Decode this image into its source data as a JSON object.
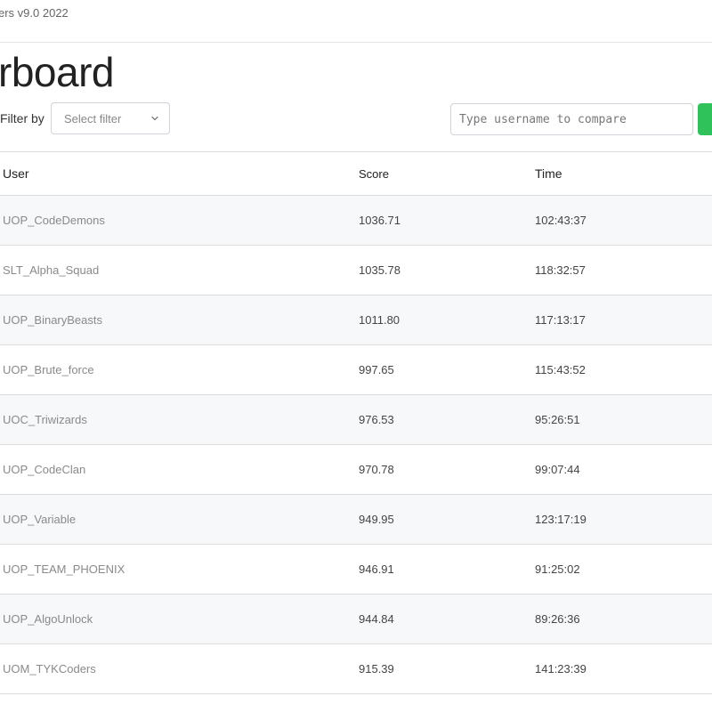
{
  "header": {
    "version_text": "ers v9.0 2022"
  },
  "page": {
    "title": "rboard"
  },
  "filter": {
    "label": "Filter by",
    "placeholder": "Select filter"
  },
  "compare": {
    "placeholder": "Type username to compare",
    "button_color": "#2fc25b"
  },
  "table": {
    "columns": [
      "User",
      "Score",
      "Time",
      ""
    ],
    "rows": [
      {
        "user": "UOP_CodeDemons",
        "score": "1036.71",
        "time": "102:43:37"
      },
      {
        "user": "SLT_Alpha_Squad",
        "score": "1035.78",
        "time": "118:32:57"
      },
      {
        "user": "UOP_BinaryBeasts",
        "score": "1011.80",
        "time": "117:13:17"
      },
      {
        "user": "UOP_Brute_force",
        "score": "997.65",
        "time": "115:43:52"
      },
      {
        "user": "UOC_Triwizards",
        "score": "976.53",
        "time": "95:26:51"
      },
      {
        "user": "UOP_CodeClan",
        "score": "970.78",
        "time": "99:07:44"
      },
      {
        "user": "UOP_Variable",
        "score": "949.95",
        "time": "123:17:19"
      },
      {
        "user": "UOP_TEAM_PHOENIX",
        "score": "946.91",
        "time": "91:25:02"
      },
      {
        "user": "UOP_AlgoUnlock",
        "score": "944.84",
        "time": "89:26:36"
      },
      {
        "user": "UOM_TYKCoders",
        "score": "915.39",
        "time": "141:23:39"
      }
    ]
  }
}
